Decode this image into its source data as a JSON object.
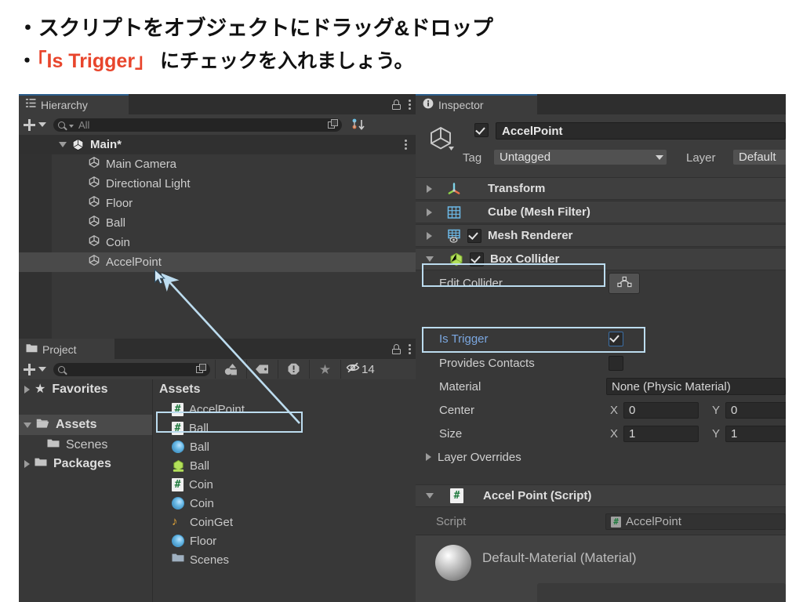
{
  "caption": {
    "line1": "・スクリプトをオブジェクトにドラッグ&ドロップ",
    "line2_bullet": "・",
    "line2_red": "「Is Trigger」",
    "line2_rest": " にチェックを入れましょう。",
    "red_color": "#e8452c"
  },
  "hierarchy": {
    "tab_label": "Hierarchy",
    "tab_icon": "hierarchy-icon",
    "lock_icon": "lock-icon",
    "menu_icon": "kebab-menu-icon",
    "add_label": "+",
    "search_placeholder": "All",
    "search_icon": "search-icon",
    "fullscreen_icon": "expand-icon",
    "sort_icon": "sort-icon",
    "scene": {
      "label": "Main*",
      "icon": "unity-scene-icon",
      "expanded": true
    },
    "objects": [
      {
        "label": "Main Camera",
        "icon": "gameobject-cube-icon",
        "selected": false
      },
      {
        "label": "Directional Light",
        "icon": "gameobject-cube-icon",
        "selected": false
      },
      {
        "label": "Floor",
        "icon": "gameobject-cube-icon",
        "selected": false
      },
      {
        "label": "Ball",
        "icon": "gameobject-cube-icon",
        "selected": false
      },
      {
        "label": "Coin",
        "icon": "gameobject-cube-icon",
        "selected": false
      },
      {
        "label": "AccelPoint",
        "icon": "gameobject-cube-icon",
        "selected": true
      }
    ]
  },
  "project": {
    "tab_label": "Project",
    "tab_icon": "folder-icon",
    "lock_icon": "lock-icon",
    "menu_icon": "kebab-menu-icon",
    "add_label": "+",
    "search_placeholder": "",
    "toolbar_icons": [
      "prefab-filter-icon",
      "label-filter-icon",
      "warning-filter-icon",
      "favorite-star-icon",
      "hidden-eye-icon"
    ],
    "hidden_count": "14",
    "tree": [
      {
        "label": "Favorites",
        "icon": "star-icon",
        "expanded": false,
        "indent": 0
      },
      {
        "label": "Assets",
        "icon": "folder-open-icon",
        "expanded": true,
        "indent": 0,
        "selected": true
      },
      {
        "label": "Scenes",
        "icon": "folder-icon",
        "expanded": null,
        "indent": 1
      },
      {
        "label": "Packages",
        "icon": "folder-icon",
        "expanded": false,
        "indent": 0
      }
    ],
    "breadcrumb": "Assets",
    "assets": [
      {
        "label": "AccelPoint",
        "icon": "csharp-script-icon",
        "highlight": true
      },
      {
        "label": "Ball",
        "icon": "csharp-script-icon"
      },
      {
        "label": "Ball",
        "icon": "material-icon"
      },
      {
        "label": "Ball",
        "icon": "prefab-icon"
      },
      {
        "label": "Coin",
        "icon": "csharp-script-icon"
      },
      {
        "label": "Coin",
        "icon": "material-icon"
      },
      {
        "label": "CoinGet",
        "icon": "audio-clip-icon"
      },
      {
        "label": "Floor",
        "icon": "material-icon"
      },
      {
        "label": "Scenes",
        "icon": "folder-icon"
      }
    ]
  },
  "inspector": {
    "tab_label": "Inspector",
    "tab_icon": "info-icon",
    "gameobject": {
      "enabled_checkbox": true,
      "name": "AccelPoint",
      "static_label": "",
      "tag_label": "Tag",
      "tag_value": "Untagged",
      "layer_label": "Layer",
      "layer_value": "Default",
      "icon": "gameobject-cube-icon"
    },
    "components": [
      {
        "name": "Transform",
        "icon": "transform-icon",
        "expanded": false,
        "has_checkbox": false
      },
      {
        "name": "Cube (Mesh Filter)",
        "icon": "mesh-filter-icon",
        "expanded": false,
        "has_checkbox": false
      },
      {
        "name": "Mesh Renderer",
        "icon": "mesh-renderer-icon",
        "expanded": false,
        "has_checkbox": true,
        "checked": true
      },
      {
        "name": "Box Collider",
        "icon": "box-collider-icon",
        "expanded": true,
        "has_checkbox": true,
        "checked": true,
        "highlight": true
      }
    ],
    "box_collider": {
      "edit_collider_label": "Edit Collider",
      "edit_collider_icon": "edit-collider-icon",
      "is_trigger_label": "Is Trigger",
      "is_trigger_value": true,
      "is_trigger_highlight": true,
      "provides_contacts_label": "Provides Contacts",
      "provides_contacts_value": false,
      "material_label": "Material",
      "material_value": "None (Physic Material)",
      "center_label": "Center",
      "center_x_axis": "X",
      "center_x": "0",
      "center_y_axis": "Y",
      "center_y": "0",
      "size_label": "Size",
      "size_x_axis": "X",
      "size_x": "1",
      "size_y_axis": "Y",
      "size_y": "1",
      "layer_overrides_label": "Layer Overrides"
    },
    "script_component": {
      "title": "Accel Point (Script)",
      "icon": "csharp-script-icon",
      "script_label": "Script",
      "script_value": "AccelPoint",
      "expanded": true
    },
    "material_preview": {
      "title": "Default-Material (Material)",
      "icon": "material-sphere-icon"
    }
  },
  "annotation": {
    "arrow_color": "#bcdcef",
    "highlight_color": "#bcdcef"
  }
}
